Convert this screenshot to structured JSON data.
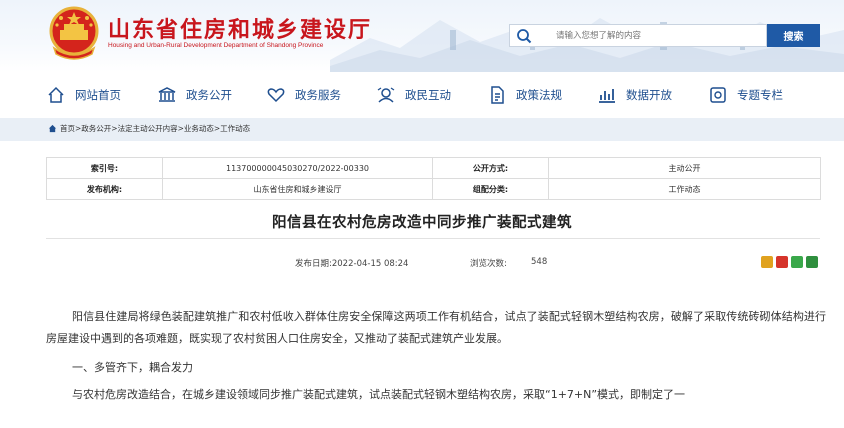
{
  "header": {
    "site_title": "山东省住房和城乡建设厅",
    "site_subtitle": "Housing and Urban-Rural Development Department of Shandong Province",
    "search": {
      "placeholder": "请输入您想了解的内容",
      "button_label": "搜索"
    }
  },
  "nav": {
    "items": [
      {
        "label": "网站首页",
        "icon": "home-icon"
      },
      {
        "label": "政务公开",
        "icon": "government-building-icon"
      },
      {
        "label": "政务服务",
        "icon": "heart-hands-icon"
      },
      {
        "label": "政民互动",
        "icon": "interaction-icon"
      },
      {
        "label": "政策法规",
        "icon": "document-icon"
      },
      {
        "label": "数据开放",
        "icon": "bar-chart-icon"
      },
      {
        "label": "专题专栏",
        "icon": "topic-icon"
      }
    ]
  },
  "breadcrumb": "首页>政务公开>法定主动公开内容>业务动态>工作动态",
  "meta": {
    "index_label": "索引号:",
    "index_value": "113700000045030270/2022-00330",
    "public_method_label": "公开方式:",
    "public_method_value": "主动公开",
    "publisher_label": "发布机构:",
    "publisher_value": "山东省住房和城乡建设厅",
    "category_label": "组配分类:",
    "category_value": "工作动态"
  },
  "article": {
    "title": "阳信县在农村危房改造中同步推广装配式建筑",
    "publish_date": "发布日期:2022-04-15 08:24",
    "views_label": "浏览次数:",
    "views_value": "548",
    "paragraph1": "阳信县住建局将绿色装配建筑推广和农村低收入群体住房安全保障这两项工作有机结合，试点了装配式轻钢木塑结构农房，破解了采取传统砖砌体结构进行房屋建设中遇到的各项难题，既实现了农村贫困人口住房安全，又推动了装配式建筑产业发展。",
    "heading1": "一、多管齐下，耦合发力",
    "paragraph2": "与农村危房改造结合，在城乡建设领域同步推广装配式建筑，试点装配式轻钢木塑结构农房，采取“1+7+N”模式，即制定了一"
  },
  "colors": {
    "brand_red": "#c8161d",
    "nav_blue": "#1f4f8f",
    "button_blue": "#1f5aa6"
  }
}
